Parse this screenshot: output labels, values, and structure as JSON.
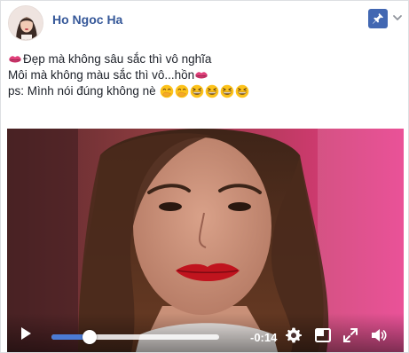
{
  "post": {
    "author": "Ho Ngoc Ha",
    "lines": [
      {
        "emoji_before": "kiss-mark",
        "text": "Đẹp mà không sâu sắc thì vô nghĩa"
      },
      {
        "text": "Môi mà không màu sắc thì vô...hồn",
        "emoji_after": "kiss-mark"
      },
      {
        "text": "ps: Mình nói đúng không nè",
        "emoji_after": [
          "face-with-hand-over-mouth",
          "face-with-hand-over-mouth",
          "grinning-squinting-face",
          "grinning-squinting-face",
          "grinning-squinting-face",
          "grinning-squinting-face"
        ]
      }
    ]
  },
  "video": {
    "time_remaining": "-0:14",
    "progress": 0.23,
    "icons": {
      "play": "play-icon",
      "settings": "gear-icon",
      "pip": "picture-in-picture-icon",
      "fullscreen": "expand-icon",
      "volume": "volume-icon"
    }
  },
  "colors": {
    "author_link": "#365899",
    "pin_button": "#4267b2",
    "progress_fill": "#4b7bd5"
  }
}
